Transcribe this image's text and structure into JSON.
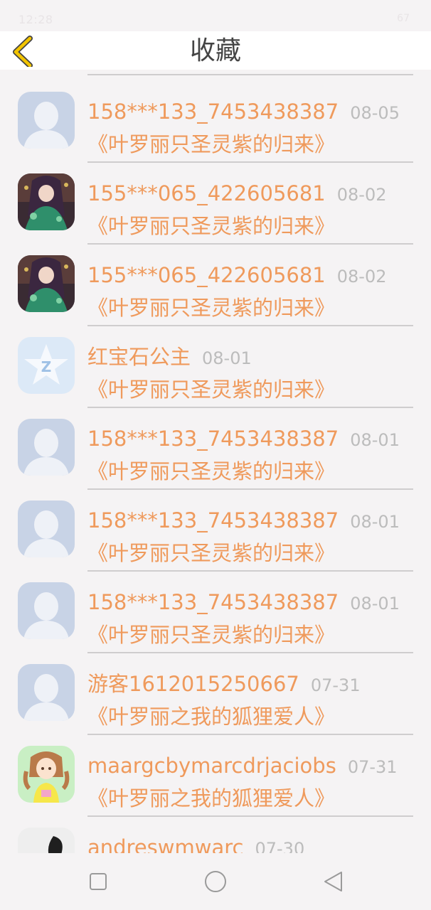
{
  "status_bar": {
    "time": "12:28",
    "signal": "4G",
    "battery": "67"
  },
  "header": {
    "title": "收藏"
  },
  "items": [
    {
      "name": "158***133_7453438387",
      "date": "08-05",
      "title": "《叶罗丽只圣灵紫的归来》",
      "avatar": "default-avatar"
    },
    {
      "name": "155***065_422605681",
      "date": "08-02",
      "title": "《叶罗丽只圣灵紫的归来》",
      "avatar": "anime-girl-avatar"
    },
    {
      "name": "155***065_422605681",
      "date": "08-02",
      "title": "《叶罗丽只圣灵紫的归来》",
      "avatar": "anime-girl-avatar"
    },
    {
      "name": "红宝石公主",
      "date": "08-01",
      "title": "《叶罗丽只圣灵紫的归来》",
      "avatar": "qq-star-avatar"
    },
    {
      "name": "158***133_7453438387",
      "date": "08-01",
      "title": "《叶罗丽只圣灵紫的归来》",
      "avatar": "default-avatar"
    },
    {
      "name": "158***133_7453438387",
      "date": "08-01",
      "title": "《叶罗丽只圣灵紫的归来》",
      "avatar": "default-avatar"
    },
    {
      "name": "158***133_7453438387",
      "date": "08-01",
      "title": "《叶罗丽只圣灵紫的归来》",
      "avatar": "default-avatar"
    },
    {
      "name": "游客1612015250667",
      "date": "07-31",
      "title": "《叶罗丽之我的狐狸爱人》",
      "avatar": "default-avatar"
    },
    {
      "name": "maargcbymarcdrjaciobs",
      "date": "07-31",
      "title": "《叶罗丽之我的狐狸爱人》",
      "avatar": "cartoon-girl-avatar"
    },
    {
      "name": "andreswmwarc",
      "date": "07-30",
      "title": "",
      "avatar": "silhouette-avatar"
    }
  ],
  "colors": {
    "accent": "#ef9a5c",
    "date": "#bcbcbc",
    "back_arrow": "#f2c400",
    "divider": "#cfcdce"
  },
  "nav": {
    "buttons": [
      "recent-apps-icon",
      "home-icon",
      "back-icon"
    ]
  }
}
